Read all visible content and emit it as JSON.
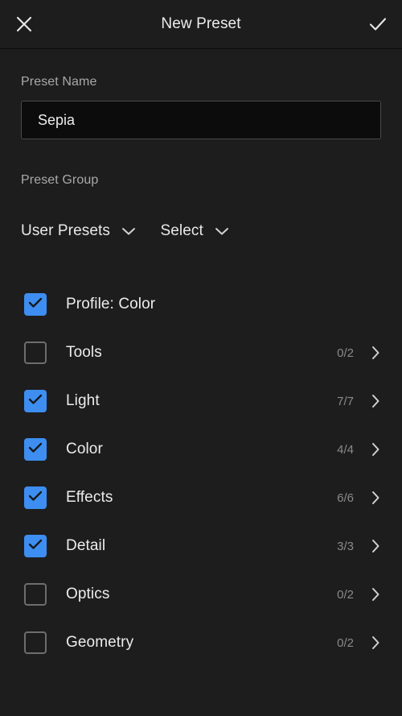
{
  "header": {
    "title": "New Preset",
    "close_icon": "close-x-icon",
    "confirm_icon": "checkmark-icon"
  },
  "form": {
    "preset_name_label": "Preset Name",
    "preset_name_value": "Sepia",
    "preset_name_placeholder": "Preset Name",
    "preset_group_label": "Preset Group",
    "preset_group_value": "User Presets",
    "select_value": "Select",
    "chevron_down_icon": "chevron-down-icon"
  },
  "checklist": {
    "chevron_right_icon": "chevron-right-icon",
    "checked_color": "#3d8ef0",
    "items": [
      {
        "label": "Profile: Color",
        "checked": true,
        "count": "",
        "has_chevron": false
      },
      {
        "label": "Tools",
        "checked": false,
        "count": "0/2",
        "has_chevron": true
      },
      {
        "label": "Light",
        "checked": true,
        "count": "7/7",
        "has_chevron": true
      },
      {
        "label": "Color",
        "checked": true,
        "count": "4/4",
        "has_chevron": true
      },
      {
        "label": "Effects",
        "checked": true,
        "count": "6/6",
        "has_chevron": true
      },
      {
        "label": "Detail",
        "checked": true,
        "count": "3/3",
        "has_chevron": true
      },
      {
        "label": "Optics",
        "checked": false,
        "count": "0/2",
        "has_chevron": true
      },
      {
        "label": "Geometry",
        "checked": false,
        "count": "0/2",
        "has_chevron": true
      }
    ]
  }
}
